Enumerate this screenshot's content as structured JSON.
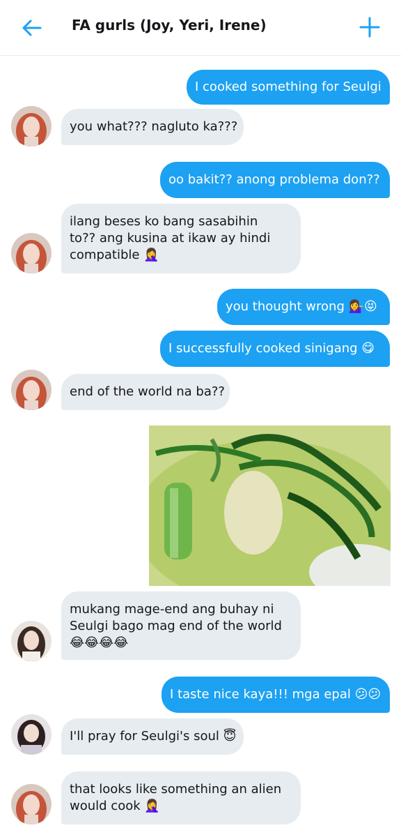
{
  "header": {
    "title": "FA gurls (Joy, Yeri, Irene)",
    "back_icon": "arrow-left-icon",
    "new_icon": "plus-icon",
    "accent_color": "#1da1f2"
  },
  "messages": [
    {
      "direction": "sent",
      "text": "I cooked something for Seulgi"
    },
    {
      "direction": "received",
      "avatar": "avatar-orange-hair",
      "text": "you what??? nagluto ka???"
    },
    {
      "direction": "sent",
      "text": "oo bakit?? anong problema don??"
    },
    {
      "direction": "received",
      "avatar": "avatar-orange-hair",
      "lines": [
        "ilang beses ko bang sasabihin",
        "to?? ang kusina at ikaw ay hindi",
        "compatible 🤦‍♀️"
      ]
    },
    {
      "direction": "sent",
      "text": "you thought wrong 💁‍♀️😝"
    },
    {
      "direction": "sent",
      "text": "I successfully cooked sinigang 😋"
    },
    {
      "direction": "received",
      "avatar": "avatar-orange-hair",
      "text": "end of the world na ba??"
    },
    {
      "direction": "sent",
      "type": "image",
      "image": "sinigang-soup-photo"
    },
    {
      "direction": "received",
      "avatar": "avatar-dark-hair",
      "lines": [
        "mukang mage-end ang buhay ni",
        "Seulgi bago mag end of the world",
        "😂😂😂😂"
      ]
    },
    {
      "direction": "sent",
      "text": "I taste nice kaya!!! mga epal 😕😕"
    },
    {
      "direction": "received",
      "avatar": "avatar-dark-hair-2",
      "text": "I'll pray for Seulgi's soul 😇"
    },
    {
      "direction": "received",
      "avatar": "avatar-orange-hair",
      "lines": [
        "that looks like something an alien",
        "would cook 🤦‍♀️"
      ]
    }
  ],
  "colors": {
    "sent_bubble": "#1da1f2",
    "received_bubble": "#e6ecf0",
    "divider": "#e6ecf0"
  }
}
